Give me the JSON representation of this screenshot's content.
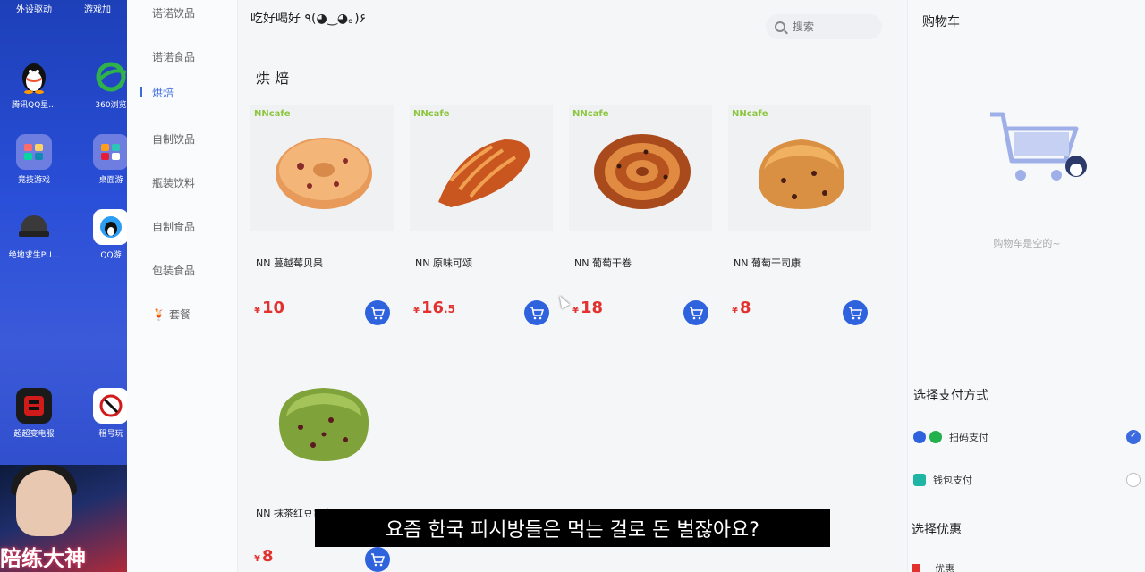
{
  "desktop": {
    "top_labels": [
      "外设驱动",
      "游戏加"
    ],
    "icons": [
      {
        "label": "腾讯QQ星...",
        "name": "qq-penguin",
        "color": "#111111"
      },
      {
        "label": "360浏览",
        "name": "browser-360",
        "color": "#2fb24a"
      },
      {
        "label": "竞技游戏",
        "name": "game-folder",
        "color": "#6d7ee0"
      },
      {
        "label": "桌面游",
        "name": "game-folder-2",
        "color": "#6d7ee0"
      },
      {
        "label": "绝地求生PU...",
        "name": "pubg",
        "color": "#333333"
      },
      {
        "label": "QQ游",
        "name": "qq-game",
        "color": "#ffffff"
      },
      {
        "label": "超超变电服",
        "name": "ghost-game",
        "color": "#d11a1a"
      },
      {
        "label": "租号玩",
        "name": "rent-game",
        "color": "#ffffff"
      }
    ],
    "banner_text": "陪练大神"
  },
  "sidebar": {
    "items": [
      {
        "label": "诺诺饮品"
      },
      {
        "label": "诺诺食品"
      },
      {
        "label": "烘焙",
        "active": true
      },
      {
        "label": "自制饮品"
      },
      {
        "label": "瓶装饮料"
      },
      {
        "label": "自制食品"
      },
      {
        "label": "包装食品"
      },
      {
        "label": "套餐",
        "emoji": "🍹"
      }
    ]
  },
  "header": {
    "greeting": "吃好喝好 ٩(◕‿◕｡)۶",
    "search_placeholder": "搜索"
  },
  "section": {
    "title": "烘 焙"
  },
  "products": [
    {
      "name": "NN 蔓越莓贝果",
      "currency": "¥",
      "price_int": "10",
      "price_dec": "",
      "brand": "NNcafe",
      "bread": "bagel"
    },
    {
      "name": "NN 原味可颂",
      "currency": "¥",
      "price_int": "16",
      "price_dec": ".5",
      "brand": "NNcafe",
      "bread": "croissant"
    },
    {
      "name": "NN 葡萄干卷",
      "currency": "¥",
      "price_int": "18",
      "price_dec": "",
      "brand": "NNcafe",
      "bread": "roll"
    },
    {
      "name": "NN 葡萄干司康",
      "currency": "¥",
      "price_int": "8",
      "price_dec": "",
      "brand": "NNcafe",
      "bread": "scone"
    },
    {
      "name": "NN 抹茶红豆司康",
      "currency": "¥",
      "price_int": "8",
      "price_dec": "",
      "brand": "",
      "bread": "matcha"
    }
  ],
  "cart": {
    "title": "购物车",
    "empty_text": "购物车是空的~",
    "payment_title": "选择支付方式",
    "payment_methods": [
      {
        "label": "扫码支付",
        "selected": true
      },
      {
        "label": "钱包支付",
        "selected": false
      }
    ],
    "coupon_title": "选择优惠",
    "coupon_item": "优惠"
  },
  "subtitle": "요즘 한국 피시방들은 먹는 걸로 돈 벌잖아요?"
}
